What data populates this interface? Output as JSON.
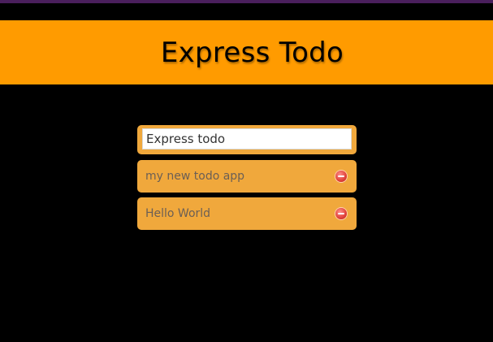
{
  "app": {
    "title": "Express Todo"
  },
  "new_todo": {
    "value": "Express todo",
    "placeholder": ""
  },
  "todos": [
    {
      "text": "my new todo app",
      "action_icon": "delete-icon"
    },
    {
      "text": "Hello World",
      "action_icon": "delete-icon"
    }
  ],
  "colors": {
    "background": "#000000",
    "header": "#ff9b00",
    "item": "#f0a83c",
    "item_text": "#6b5f55",
    "delete": "#e0413b",
    "top_strip": "#4a1f5c"
  }
}
